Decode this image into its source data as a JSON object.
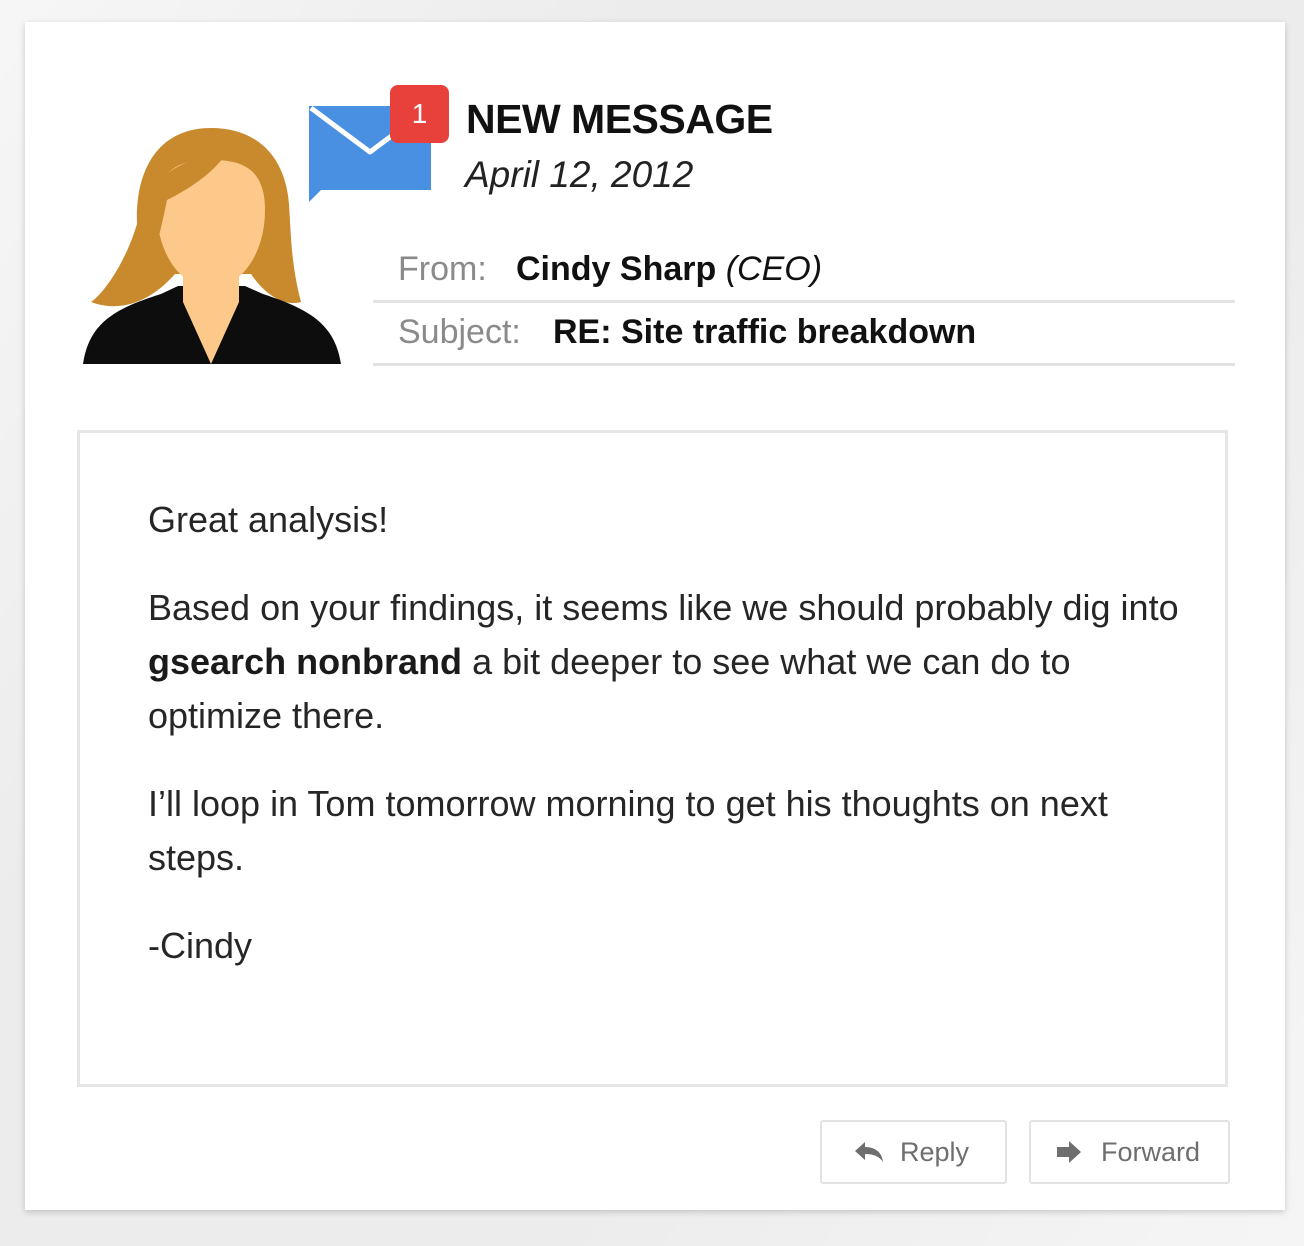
{
  "notification": {
    "badge_count": "1",
    "title": "NEW MESSAGE",
    "date": "April 12, 2012"
  },
  "header": {
    "from_label": "From:",
    "from_name": "Cindy Sharp",
    "from_role": "(CEO)",
    "subject_label": "Subject:",
    "subject_value": "RE: Site traffic breakdown"
  },
  "message": {
    "greeting": "Great analysis!",
    "p2_before": "Based on your findings, it seems like we should probably dig into ",
    "p2_bold": "gsearch nonbrand",
    "p2_after": " a bit deeper to see what we can do to optimize there.",
    "p3": "I’ll loop in Tom tomorrow morning to get his thoughts on next steps.",
    "signature": "-Cindy"
  },
  "actions": {
    "reply_label": "Reply",
    "forward_label": "Forward"
  },
  "icons": {
    "avatar": "woman-avatar-icon",
    "mail": "envelope-icon",
    "reply": "reply-arrow-icon",
    "forward": "forward-arrow-icon"
  },
  "colors": {
    "badge": "#e8413c",
    "envelope": "#4a90e2",
    "hair": "#c88a2c",
    "skin": "#fcc98a"
  }
}
